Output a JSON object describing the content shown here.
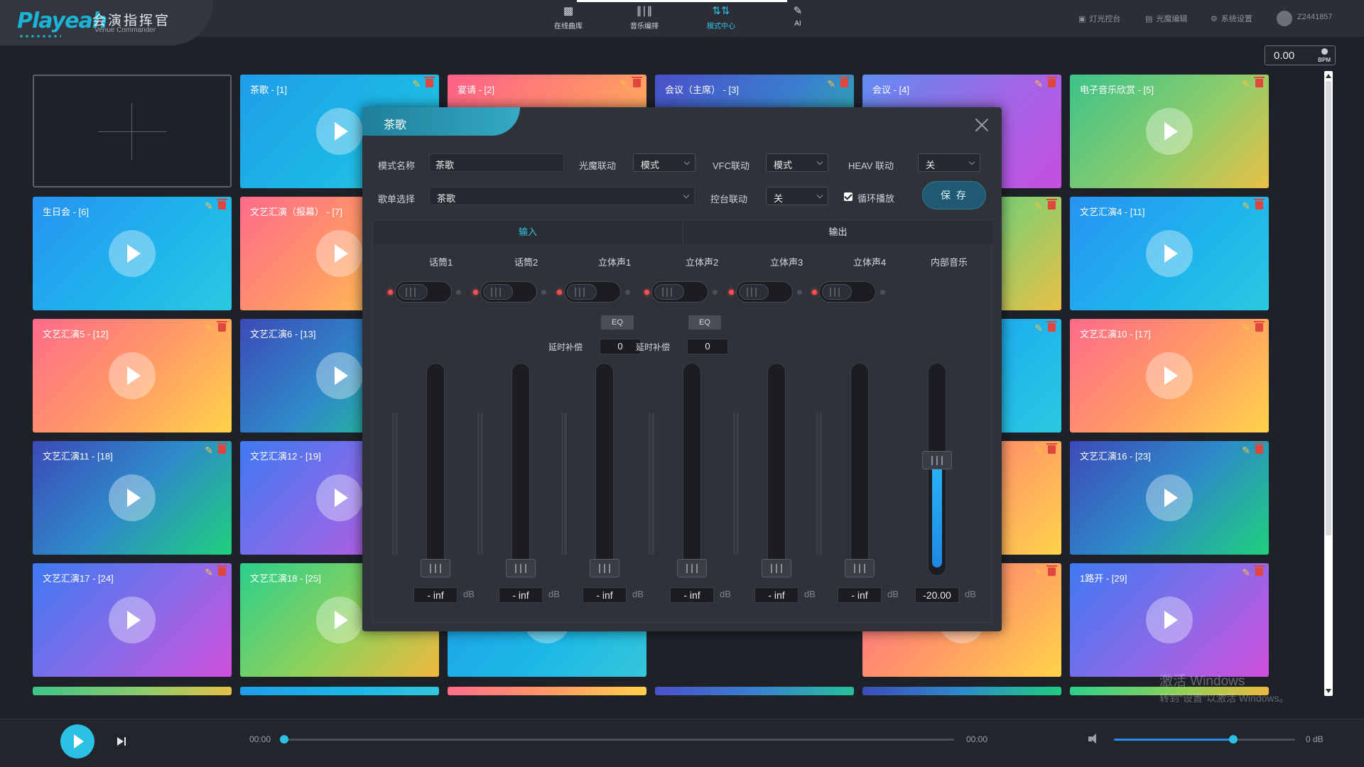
{
  "app": {
    "logo": "Playeah",
    "title": "会演指挥官",
    "subtitle": "Venue Commander"
  },
  "nav": [
    {
      "label": "在线曲库",
      "icon": "music-library-icon",
      "active": false
    },
    {
      "label": "音乐编排",
      "icon": "waveform-icon",
      "active": false
    },
    {
      "label": "模式中心",
      "icon": "sliders-icon",
      "active": true
    },
    {
      "label": "AI",
      "icon": "ai-edit-icon",
      "active": false
    }
  ],
  "right_menu": {
    "light_console": "灯光控台",
    "light_magic_edit": "光魔编辑",
    "system_settings": "系统设置",
    "user": "Z2441857"
  },
  "bpm": {
    "value": "0.00",
    "unit": "BPM"
  },
  "cards": [
    {
      "title": "茶歌 - [1]",
      "gradient": "g-a"
    },
    {
      "title": "宴请 - [2]",
      "gradient": "g-b"
    },
    {
      "title": "会议（主席） - [3]",
      "gradient": "g-c"
    },
    {
      "title": "会议 - [4]",
      "gradient": "g-d"
    },
    {
      "title": "电子音乐欣赏 - [5]",
      "gradient": "g-e"
    },
    {
      "title": "生日会 - [6]",
      "gradient": "g-f"
    },
    {
      "title": "文艺汇演（报幕） - [7]",
      "gradient": "g-g"
    },
    {
      "title": "",
      "gradient": "g-e"
    },
    {
      "title": "",
      "gradient": "g-e"
    },
    {
      "title": "文艺汇演4 - [11]",
      "gradient": "g-f"
    },
    {
      "title": "文艺汇演5 - [12]",
      "gradient": "g-g"
    },
    {
      "title": "文艺汇演6 - [13]",
      "gradient": "g-h"
    },
    {
      "title": "",
      "gradient": "g-a"
    },
    {
      "title": "",
      "gradient": "g-f"
    },
    {
      "title": "文艺汇演10 - [17]",
      "gradient": "g-g"
    },
    {
      "title": "文艺汇演11 - [18]",
      "gradient": "g-h"
    },
    {
      "title": "文艺汇演12 - [19]",
      "gradient": "g-i"
    },
    {
      "title": "",
      "gradient": "g-g"
    },
    {
      "title": "",
      "gradient": "g-g"
    },
    {
      "title": "文艺汇演16 - [23]",
      "gradient": "g-h"
    },
    {
      "title": "文艺汇演17 - [24]",
      "gradient": "g-i"
    },
    {
      "title": "文艺汇演18 - [25]",
      "gradient": "g-j"
    },
    {
      "title": "",
      "gradient": "g-a"
    },
    {
      "title": "",
      "gradient": "g-g"
    },
    {
      "title": "1路开 - [29]",
      "gradient": "g-i"
    }
  ],
  "watermark": {
    "line1": "激活 Windows",
    "line2": "转到\"设置\"以激活 Windows。"
  },
  "player": {
    "time_current": "00:00",
    "time_total": "00:00",
    "progress": 0,
    "volume_level": 0.66,
    "volume_db": "0 dB"
  },
  "modal": {
    "title": "茶歌",
    "mode_name_label": "模式名称",
    "mode_name_value": "茶歌",
    "light_link_label": "光魔联动",
    "light_link_value": "模式",
    "vfc_link_label": "VFC联动",
    "vfc_link_value": "模式",
    "heav_link_label": "HEAV 联动",
    "heav_link_value": "关",
    "playlist_label": "歌单选择",
    "playlist_value": "茶歌",
    "console_link_label": "控台联动",
    "console_link_value": "关",
    "loop_label": "循环播放",
    "loop_checked": true,
    "save_label": "保 存",
    "tab_input": "输入",
    "tab_output": "输出",
    "eq_label": "EQ",
    "delay_label": "延时补偿",
    "db_unit": "dB",
    "channels": [
      {
        "name": "话筒1",
        "db": "- inf",
        "level": 0.0,
        "eq": false
      },
      {
        "name": "话筒2",
        "db": "- inf",
        "level": 0.0,
        "eq": false
      },
      {
        "name": "立体声1",
        "db": "- inf",
        "level": 0.0,
        "eq": true,
        "delay": "0"
      },
      {
        "name": "立体声2",
        "db": "- inf",
        "level": 0.0,
        "eq": true,
        "delay": "0"
      },
      {
        "name": "立体声3",
        "db": "- inf",
        "level": 0.0,
        "eq": false
      },
      {
        "name": "立体声4",
        "db": "- inf",
        "level": 0.0,
        "eq": false
      },
      {
        "name": "内部音乐",
        "db": "-20.00",
        "level": 0.55,
        "eq": false
      }
    ]
  }
}
